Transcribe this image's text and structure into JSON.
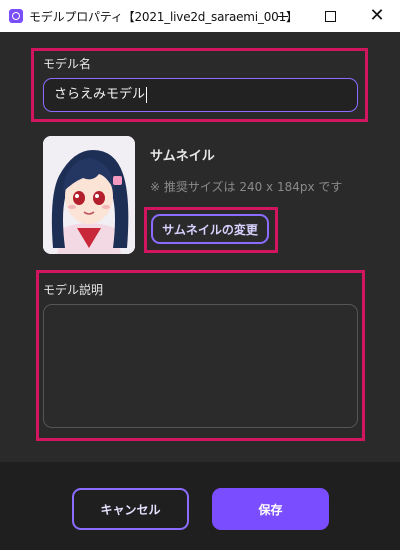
{
  "window": {
    "title": "モデルプロパティ【2021_live2d_saraemi_001】",
    "minimize_icon": "minimize-icon",
    "maximize_icon": "maximize-icon",
    "close_icon": "close-icon",
    "close_glyph": "✕"
  },
  "form": {
    "name_label": "モデル名",
    "name_value": "さらえみモデル",
    "thumbnail_label": "サムネイル",
    "thumbnail_note": "※ 推奨サイズは 240 x 184px です",
    "thumbnail_button": "サムネイルの変更",
    "description_label": "モデル説明",
    "description_value": ""
  },
  "footer": {
    "cancel_label": "キャンセル",
    "save_label": "保存"
  },
  "colors": {
    "accent": "#7a4dff",
    "highlight": "#d2155f",
    "background": "#2a2a2a"
  }
}
